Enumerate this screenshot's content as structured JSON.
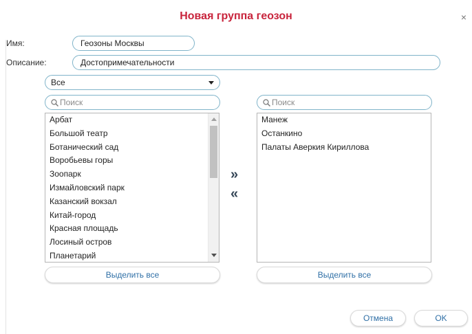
{
  "dialog": {
    "title": "Новая группа геозон",
    "close_glyph": "×"
  },
  "form": {
    "name_label": "Имя:",
    "name_value": "Геозоны Москвы",
    "description_label": "Описание:",
    "description_value": "Достопримечательности"
  },
  "left_panel": {
    "filter_selected": "Все",
    "search_placeholder": "Поиск",
    "items": [
      "Арбат",
      "Большой театр",
      "Ботанический сад",
      "Воробьевы горы",
      "Зоопарк",
      "Измайловский парк",
      "Казанский вокзал",
      "Китай-город",
      "Красная площадь",
      "Лосиный остров",
      "Планетарий"
    ],
    "select_all_label": "Выделить все"
  },
  "right_panel": {
    "search_placeholder": "Поиск",
    "items": [
      "Манеж",
      "Останкино",
      "Палаты Аверкия Кириллова"
    ],
    "select_all_label": "Выделить все"
  },
  "transfer": {
    "add_glyph": "»",
    "remove_glyph": "«"
  },
  "footer": {
    "cancel_label": "Отмена",
    "ok_label": "OK"
  },
  "icons": {
    "search": "search-icon",
    "dropdown": "chevron-down-icon",
    "close": "close-icon"
  },
  "colors": {
    "title": "#c8243c",
    "field_border": "#7fb3c9",
    "button_text": "#2f6fa6"
  }
}
